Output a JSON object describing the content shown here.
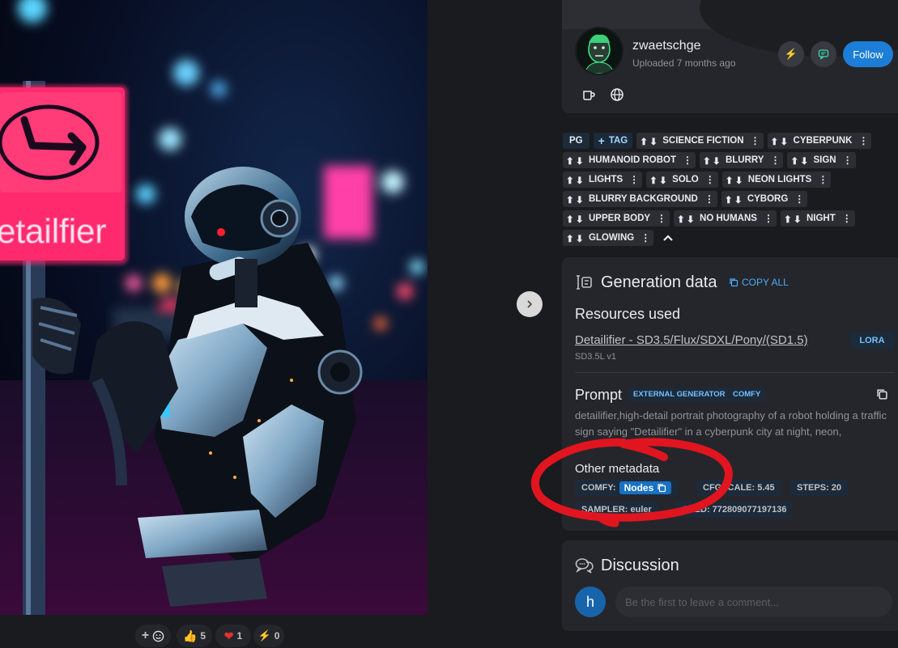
{
  "image": {
    "sign_text": "etailfier"
  },
  "reactions": [
    {
      "icon": "smiley-add-icon",
      "label": "+"
    },
    {
      "icon": "thumbs-up-icon",
      "count": "5"
    },
    {
      "icon": "heart-icon",
      "count": "1"
    },
    {
      "icon": "lightning-icon",
      "count": "0"
    }
  ],
  "profile": {
    "username": "zwaetschge",
    "uploaded": "Uploaded 7 months ago",
    "follow_label": "Follow"
  },
  "tags": {
    "rating": "PG",
    "add_tag": "TAG",
    "items": [
      "SCIENCE FICTION",
      "CYBERPUNK",
      "HUMANOID ROBOT",
      "BLURRY",
      "SIGN",
      "LIGHTS",
      "SOLO",
      "NEON LIGHTS",
      "BLURRY BACKGROUND",
      "CYBORG",
      "UPPER BODY",
      "NO HUMANS",
      "NIGHT",
      "GLOWING"
    ]
  },
  "generation": {
    "title": "Generation data",
    "copy_all": "COPY ALL",
    "resources_title": "Resources used",
    "resource_name": "Detailifier - SD3.5/Flux/SDXL/Pony/(SD1.5)",
    "resource_version": "SD3.5L v1",
    "resource_type": "LORA",
    "prompt_title": "Prompt",
    "prompt_badges": [
      "EXTERNAL GENERATOR",
      "COMFY"
    ],
    "prompt_text": "detailifier,high-detail portrait photography of a robot holding a traffic sign saying \"Detailifier\" in a cyberpunk city at night, neon,",
    "meta_title": "Other metadata",
    "meta": {
      "comfy_label": "COMFY:",
      "nodes_label": "Nodes",
      "cfg": "CFGSCALE: 5.45",
      "steps": "STEPS: 20",
      "sampler": "SAMPLER: euler",
      "seed": "SEED: 772809077197136"
    }
  },
  "discussion": {
    "title": "Discussion",
    "avatar_letter": "h",
    "placeholder": "Be the first to leave a comment..."
  },
  "colors": {
    "accent": "#1c7ed6",
    "annotation": "#e0151f",
    "sign": "#ff2a6d"
  }
}
